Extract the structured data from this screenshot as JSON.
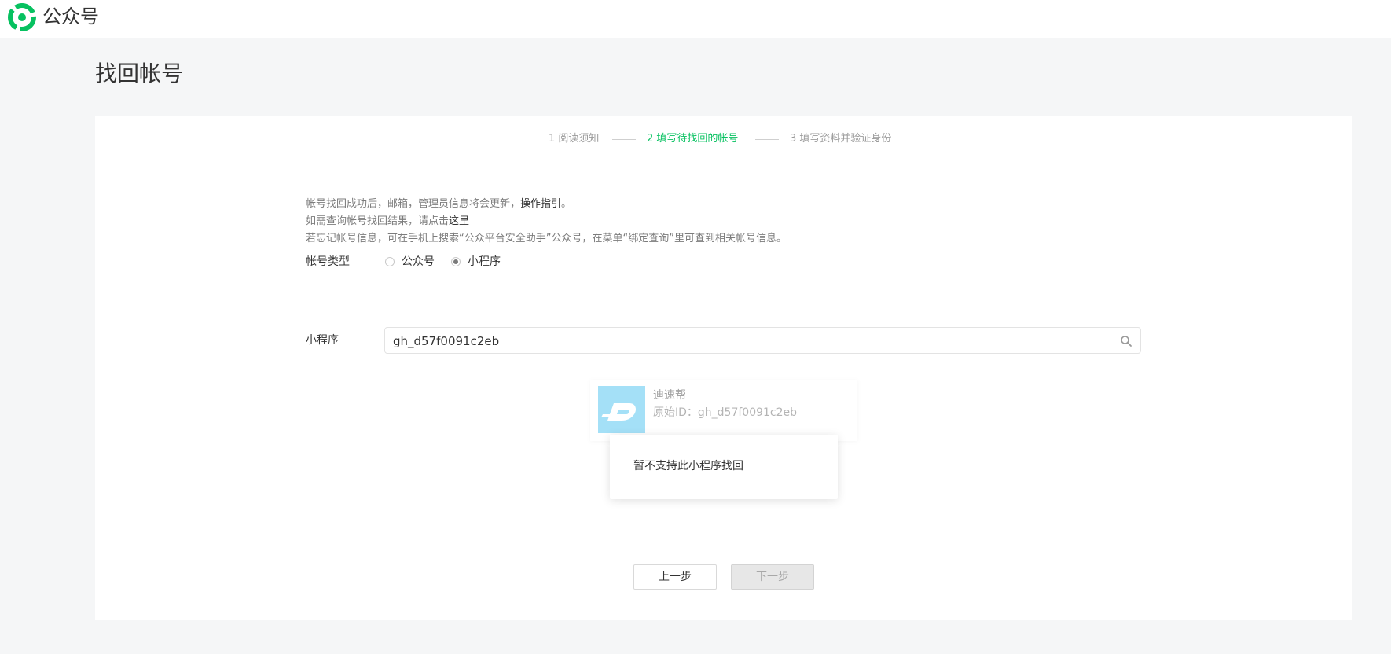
{
  "header": {
    "brand": "公众号",
    "logo_icon": "wechat-official-accounts-logo"
  },
  "page": {
    "title": "找回帐号"
  },
  "steps": [
    {
      "label": "1 阅读须知",
      "active": false
    },
    {
      "label": "2 填写待找回的帐号",
      "active": true
    },
    {
      "label": "3 填写资料并验证身份",
      "active": false
    }
  ],
  "notice": {
    "line1_prefix": "帐号找回成功后，邮箱，管理员信息将会更新，",
    "line1_link": "操作指引",
    "line1_suffix": "。",
    "line2_prefix": "如需查询帐号找回结果，请点击",
    "line2_link": "这里",
    "line3": "若忘记帐号信息，可在手机上搜索“公众平台安全助手”公众号，在菜单“绑定查询”里可查到相关帐号信息。"
  },
  "form": {
    "account_type_label": "帐号类型",
    "options": [
      {
        "label": "公众号",
        "checked": false
      },
      {
        "label": "小程序",
        "checked": true
      }
    ],
    "miniprogram_label": "小程序",
    "search_value": "gh_d57f0091c2eb",
    "search_icon": "search-icon"
  },
  "result": {
    "name": "迪速帮",
    "id_text": "原始ID：gh_d57f0091c2eb"
  },
  "tooltip": {
    "text": "暂不支持此小程序找回"
  },
  "buttons": {
    "prev": "上一步",
    "next": "下一步"
  },
  "colors": {
    "accent": "#07c160",
    "text": "#333333",
    "muted": "#7c7c7c",
    "background": "#f5f6f7"
  }
}
